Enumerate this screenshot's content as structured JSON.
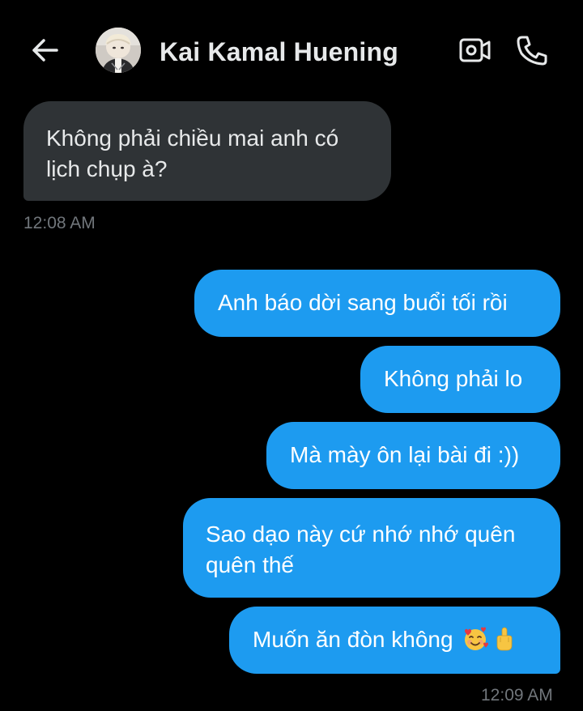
{
  "header": {
    "contact_name": "Kai Kamal Huening",
    "back_icon": "arrow-left-icon",
    "video_icon": "video-camera-icon",
    "call_icon": "phone-icon"
  },
  "colors": {
    "background": "#000000",
    "incoming_bubble": "#2f3336",
    "outgoing_bubble": "#1d9bf0",
    "timestamp": "#71767b"
  },
  "messages": [
    {
      "direction": "incoming",
      "lines": [
        "Không phải chiều mai anh có",
        "lịch chụp à?"
      ]
    },
    {
      "direction": "outgoing",
      "lines": [
        "Anh báo dời sang buổi tối rồi"
      ]
    },
    {
      "direction": "outgoing",
      "lines": [
        "Không phải lo"
      ]
    },
    {
      "direction": "outgoing",
      "lines": [
        "Mà mày ôn lại bài đi :))"
      ]
    },
    {
      "direction": "outgoing",
      "lines": [
        "Sao dạo này cứ nhớ nhớ quên",
        "quên thế"
      ]
    },
    {
      "direction": "outgoing",
      "lines": [
        "Muốn ăn đòn không"
      ],
      "emojis": [
        "smiling-face-with-hearts",
        "middle-finger"
      ]
    }
  ],
  "timestamps": {
    "incoming": "12:08 AM",
    "outgoing": "12:09 AM"
  }
}
